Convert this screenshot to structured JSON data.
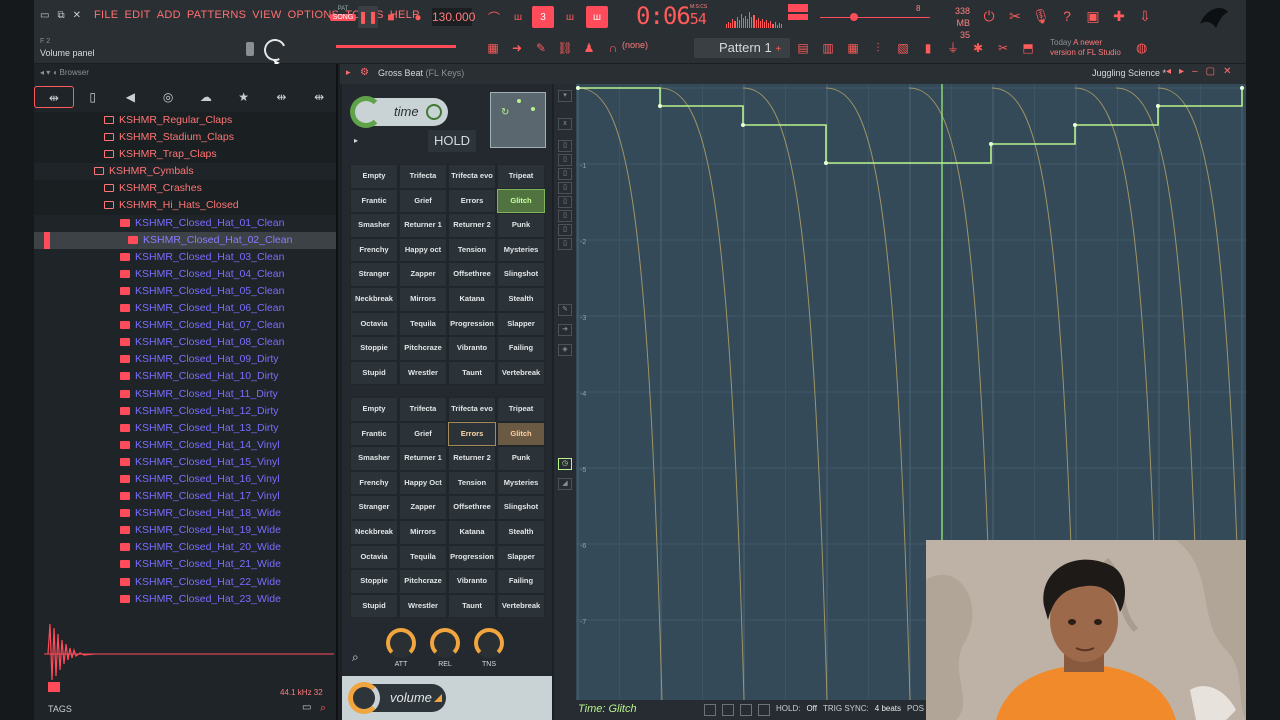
{
  "menu": [
    "FILE",
    "EDIT",
    "ADD",
    "PATTERNS",
    "VIEW",
    "OPTIONS",
    "TOOLS",
    "HELP"
  ],
  "transport": {
    "pat_label": "PAT",
    "song_label": "SONG",
    "tempo": "130.000",
    "time_main": "0:06",
    "time_small": "54",
    "time_label": "M:S:CS"
  },
  "memory": {
    "mb": "338 MB",
    "count": "35"
  },
  "cpu_small": "8",
  "hint": "Volume panel",
  "hint_top": "F  2",
  "pattern": "Pattern 1",
  "mixer_target": "(none)",
  "news": {
    "line1": "Today",
    "line1b": "A newer",
    "line2": "version of FL Studio"
  },
  "browser": {
    "title": "Browser",
    "tabs": [
      "all",
      "file",
      "speaker",
      "plugin",
      "cloud",
      "star",
      "tag1",
      "tag2"
    ],
    "items": [
      {
        "label": "KSHMR_Regular_Claps",
        "kind": "folder",
        "indent": 1
      },
      {
        "label": "KSHMR_Stadium_Claps",
        "kind": "folder",
        "indent": 1
      },
      {
        "label": "KSHMR_Trap_Claps",
        "kind": "folder",
        "indent": 1
      },
      {
        "label": "KSHMR_Cymbals",
        "kind": "folder",
        "indent": 0
      },
      {
        "label": "KSHMR_Crashes",
        "kind": "folder",
        "indent": 1
      },
      {
        "label": "KSHMR_Hi_Hats_Closed",
        "kind": "folder",
        "indent": 1
      },
      {
        "label": "KSHMR_Closed_Hat_01_Clean",
        "kind": "file",
        "indent": 2
      },
      {
        "label": "KSHMR_Closed_Hat_02_Clean",
        "kind": "file",
        "indent": 3,
        "selected": true
      },
      {
        "label": "KSHMR_Closed_Hat_03_Clean",
        "kind": "file",
        "indent": 2
      },
      {
        "label": "KSHMR_Closed_Hat_04_Clean",
        "kind": "file",
        "indent": 2
      },
      {
        "label": "KSHMR_Closed_Hat_05_Clean",
        "kind": "file",
        "indent": 2
      },
      {
        "label": "KSHMR_Closed_Hat_06_Clean",
        "kind": "file",
        "indent": 2
      },
      {
        "label": "KSHMR_Closed_Hat_07_Clean",
        "kind": "file",
        "indent": 2
      },
      {
        "label": "KSHMR_Closed_Hat_08_Clean",
        "kind": "file",
        "indent": 2
      },
      {
        "label": "KSHMR_Closed_Hat_09_Dirty",
        "kind": "file",
        "indent": 2
      },
      {
        "label": "KSHMR_Closed_Hat_10_Dirty",
        "kind": "file",
        "indent": 2
      },
      {
        "label": "KSHMR_Closed_Hat_11_Dirty",
        "kind": "file",
        "indent": 2
      },
      {
        "label": "KSHMR_Closed_Hat_12_Dirty",
        "kind": "file",
        "indent": 2
      },
      {
        "label": "KSHMR_Closed_Hat_13_Dirty",
        "kind": "file",
        "indent": 2
      },
      {
        "label": "KSHMR_Closed_Hat_14_Vinyl",
        "kind": "file",
        "indent": 2
      },
      {
        "label": "KSHMR_Closed_Hat_15_Vinyl",
        "kind": "file",
        "indent": 2
      },
      {
        "label": "KSHMR_Closed_Hat_16_Vinyl",
        "kind": "file",
        "indent": 2
      },
      {
        "label": "KSHMR_Closed_Hat_17_Vinyl",
        "kind": "file",
        "indent": 2
      },
      {
        "label": "KSHMR_Closed_Hat_18_Wide",
        "kind": "file",
        "indent": 2
      },
      {
        "label": "KSHMR_Closed_Hat_19_Wide",
        "kind": "file",
        "indent": 2
      },
      {
        "label": "KSHMR_Closed_Hat_20_Wide",
        "kind": "file",
        "indent": 2
      },
      {
        "label": "KSHMR_Closed_Hat_21_Wide",
        "kind": "file",
        "indent": 2
      },
      {
        "label": "KSHMR_Closed_Hat_22_Wide",
        "kind": "file",
        "indent": 2
      },
      {
        "label": "KSHMR_Closed_Hat_23_Wide",
        "kind": "file",
        "indent": 2
      }
    ],
    "samplerate": "44.1 kHz 32",
    "tags_label": "TAGS"
  },
  "plugin": {
    "title": "Gross Beat",
    "subtitle": "(FL Keys)",
    "preset": "Juggling Science *",
    "time_label": "time",
    "hold_label": "HOLD",
    "volume_label": "volume",
    "time_presets": [
      "Empty",
      "Trifecta",
      "Trifecta evo",
      "Tripeat",
      "Frantic",
      "Grief",
      "Errors",
      "Glitch",
      "Smasher",
      "Returner 1",
      "Returner 2",
      "Punk",
      "Frenchy",
      "Happy oct",
      "Tension",
      "Mysteries",
      "Stranger",
      "Zapper",
      "Offsethree",
      "Slingshot",
      "Neckbreak",
      "Mirrors",
      "Katana",
      "Stealth",
      "Octavia",
      "Tequila",
      "Progression",
      "Slapper",
      "Stoppie",
      "Pitchcraze",
      "Vibranto",
      "Failing",
      "Stupid",
      "Wrestler",
      "Taunt",
      "Vertebreak"
    ],
    "volume_presets": [
      "Empty",
      "Trifecta",
      "Trifecta evo",
      "Tripeat",
      "Frantic",
      "Grief",
      "Errors",
      "Glitch",
      "Smasher",
      "Returner 1",
      "Returner 2",
      "Punk",
      "Frenchy",
      "Happy Oct",
      "Tension",
      "Mysteries",
      "Stranger",
      "Zapper",
      "Offsethree",
      "Slingshot",
      "Neckbreak",
      "Mirrors",
      "Katana",
      "Stealth",
      "Octavia",
      "Tequila",
      "Progression",
      "Slapper",
      "Stoppie",
      "Pitchcraze",
      "Vibranto",
      "Failing",
      "Stupid",
      "Wrestler",
      "Taunt",
      "Vertebreak"
    ],
    "selected_time_preset": "Glitch",
    "selected_volume_preset": "Glitch",
    "knobs": [
      "ATT",
      "REL",
      "TNS"
    ],
    "grid_labels": [
      "-1",
      "-2",
      "-3",
      "-4",
      "-5",
      "-6",
      "-7"
    ],
    "status_caption": "Time: Glitch",
    "hold_status_label": "HOLD:",
    "hold_status_value": "Off",
    "trig_label": "TRIG SYNC:",
    "trig_value": "4 beats",
    "pos_label": "POS",
    "colors": {
      "accent": "#ff4b5a",
      "green": "#b9f28d",
      "env_bg": "#344a58",
      "orange": "#f0a53f"
    }
  }
}
